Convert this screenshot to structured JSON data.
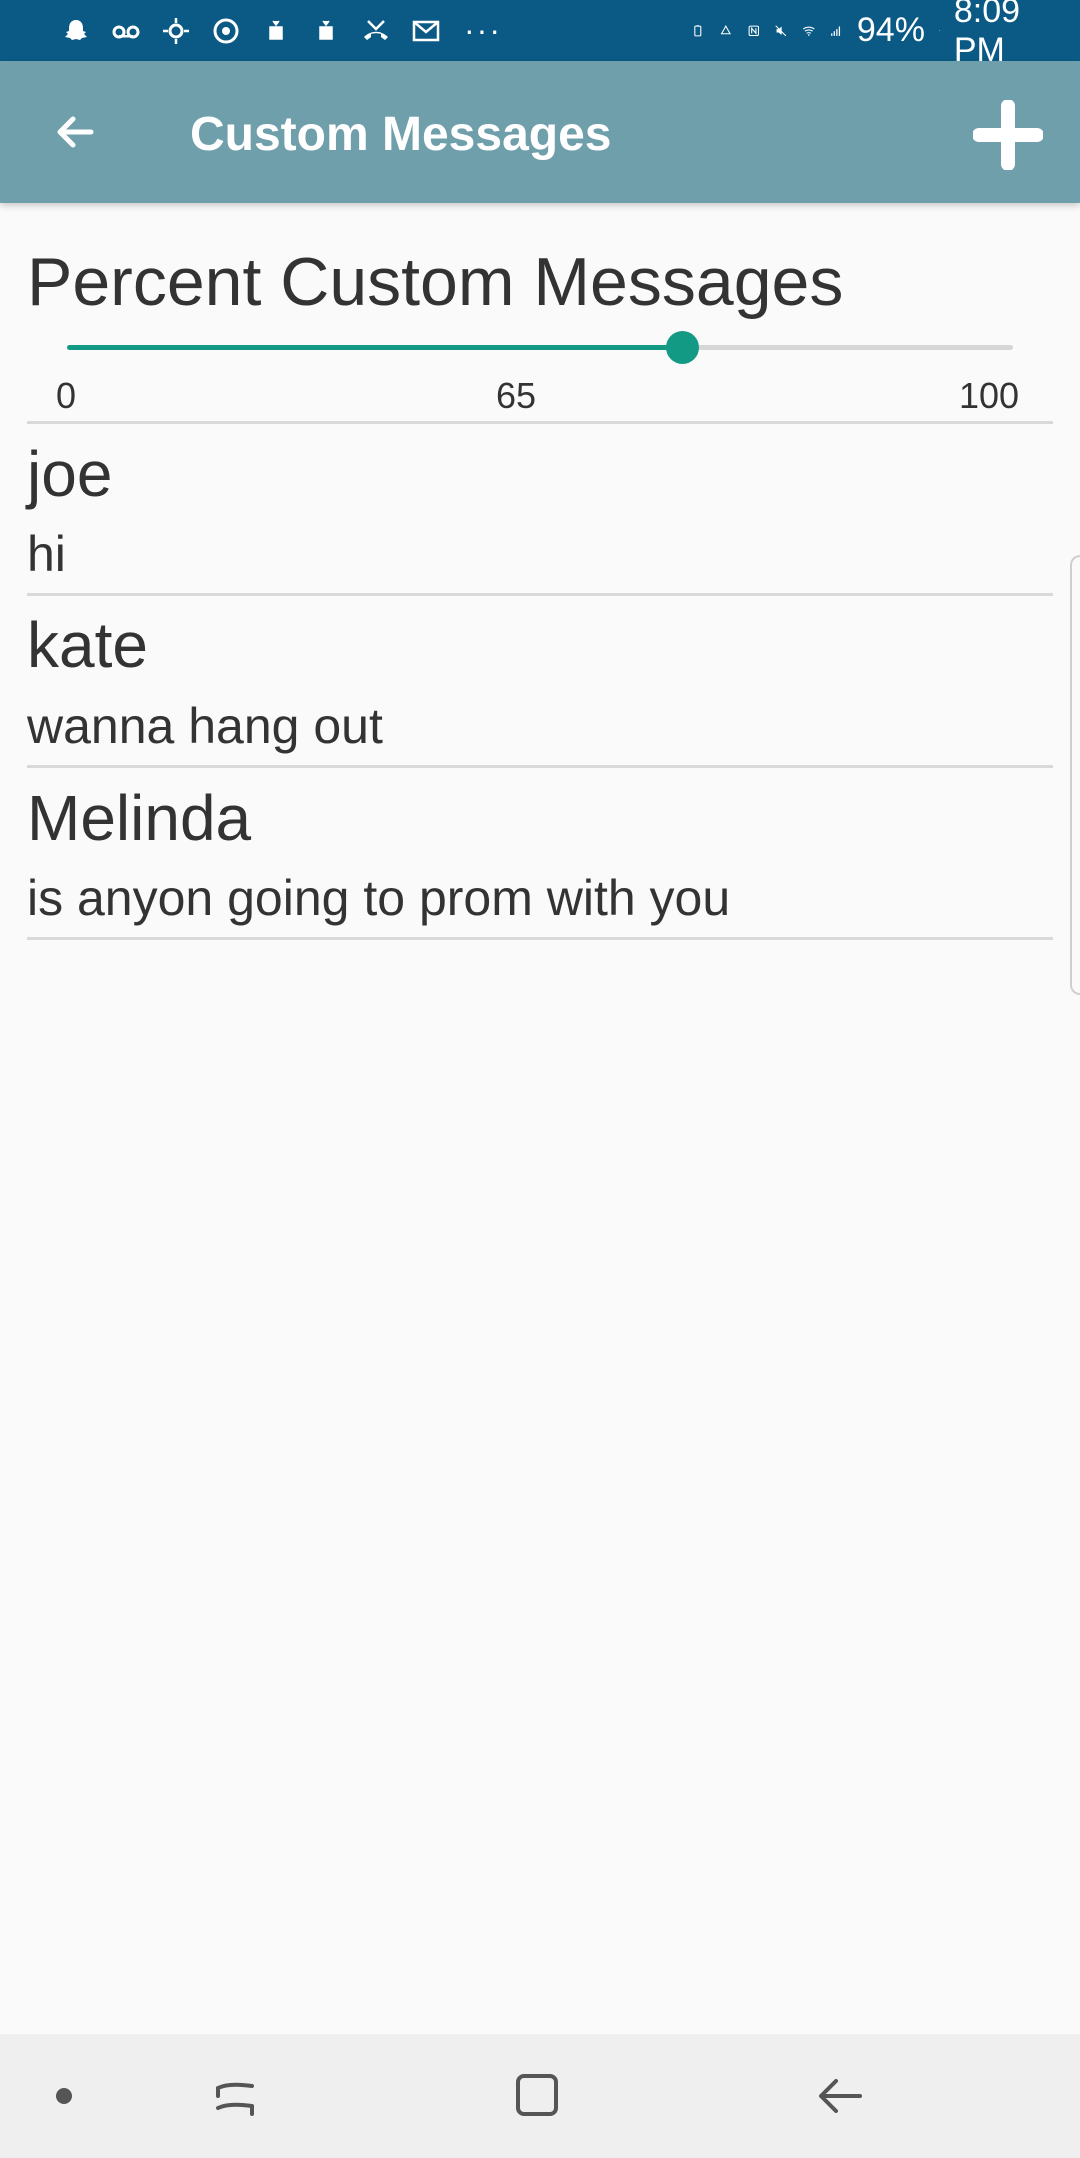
{
  "status_bar": {
    "battery": "94%",
    "time": "8:09 PM",
    "overflow": "···",
    "left_icons": [
      "snapchat-icon",
      "voicemail-icon",
      "weather-icon",
      "sync-icon",
      "android-icon",
      "android-icon",
      "missed-call-icon",
      "gallery-icon"
    ],
    "right_icons": [
      "battery-saver-icon",
      "recycle-icon",
      "nfc-icon",
      "mute-icon",
      "wifi-icon",
      "signal-icon",
      "battery-icon"
    ]
  },
  "app_bar": {
    "title": "Custom Messages",
    "back_icon": "arrow-back-icon",
    "add_icon": "plus-icon",
    "color": "#6f9fab"
  },
  "percent_section": {
    "title": "Percent Custom Messages",
    "slider": {
      "min": 0,
      "max": 100,
      "value": 65,
      "accent": "#129a85"
    },
    "tick_labels": [
      "0",
      "65",
      "100"
    ]
  },
  "messages": [
    {
      "name": "joe",
      "text": "hi"
    },
    {
      "name": "kate",
      "text": "wanna hang out"
    },
    {
      "name": "Melinda",
      "text": "is anyon going to prom with you"
    }
  ],
  "nav_bar": {
    "icons": [
      "dot-icon",
      "recent-apps-icon",
      "home-icon",
      "back-icon"
    ]
  }
}
